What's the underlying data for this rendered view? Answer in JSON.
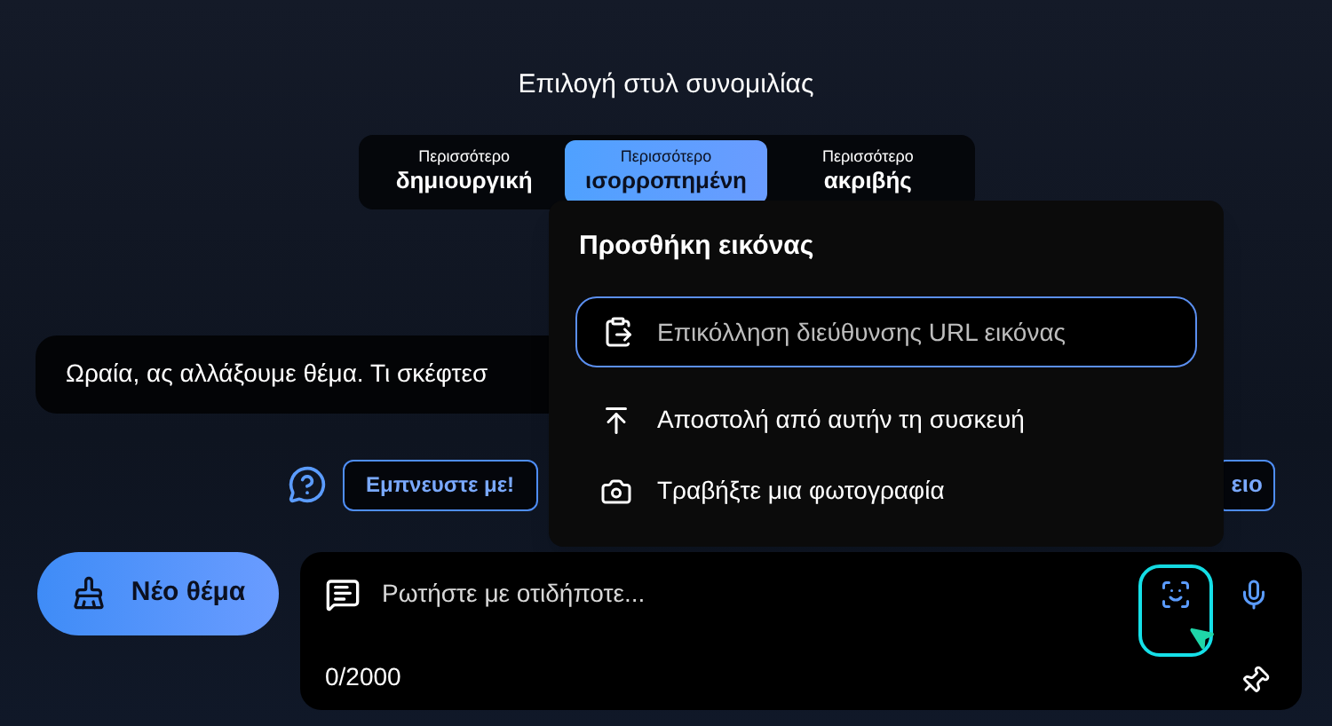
{
  "heading": "Επιλογή στυλ συνομιλίας",
  "tones": [
    {
      "top": "Περισσότερο",
      "bottom": "δημιουργική",
      "selected": false
    },
    {
      "top": "Περισσότερο",
      "bottom": "ισορροπημένη",
      "selected": true
    },
    {
      "top": "Περισσότερο",
      "bottom": "ακριβής",
      "selected": false
    }
  ],
  "message": "Ωραία, ας αλλάξουμε θέμα. Τι σκέφτεσ",
  "inspire_button": "Εμπνευστε με!",
  "side_button": "ειο",
  "new_topic_button": "Νέο θέμα",
  "composer": {
    "placeholder": "Ρωτήστε με οτιδήποτε...",
    "counter": "0/2000"
  },
  "image_popup": {
    "title": "Προσθήκη εικόνας",
    "url_placeholder": "Επικόλληση διεύθυνσης URL εικόνας",
    "options": [
      {
        "kind": "upload",
        "label": "Αποστολή από αυτήν τη συσκευή"
      },
      {
        "kind": "camera",
        "label": "Τραβήξτε μια φωτογραφία"
      }
    ]
  }
}
